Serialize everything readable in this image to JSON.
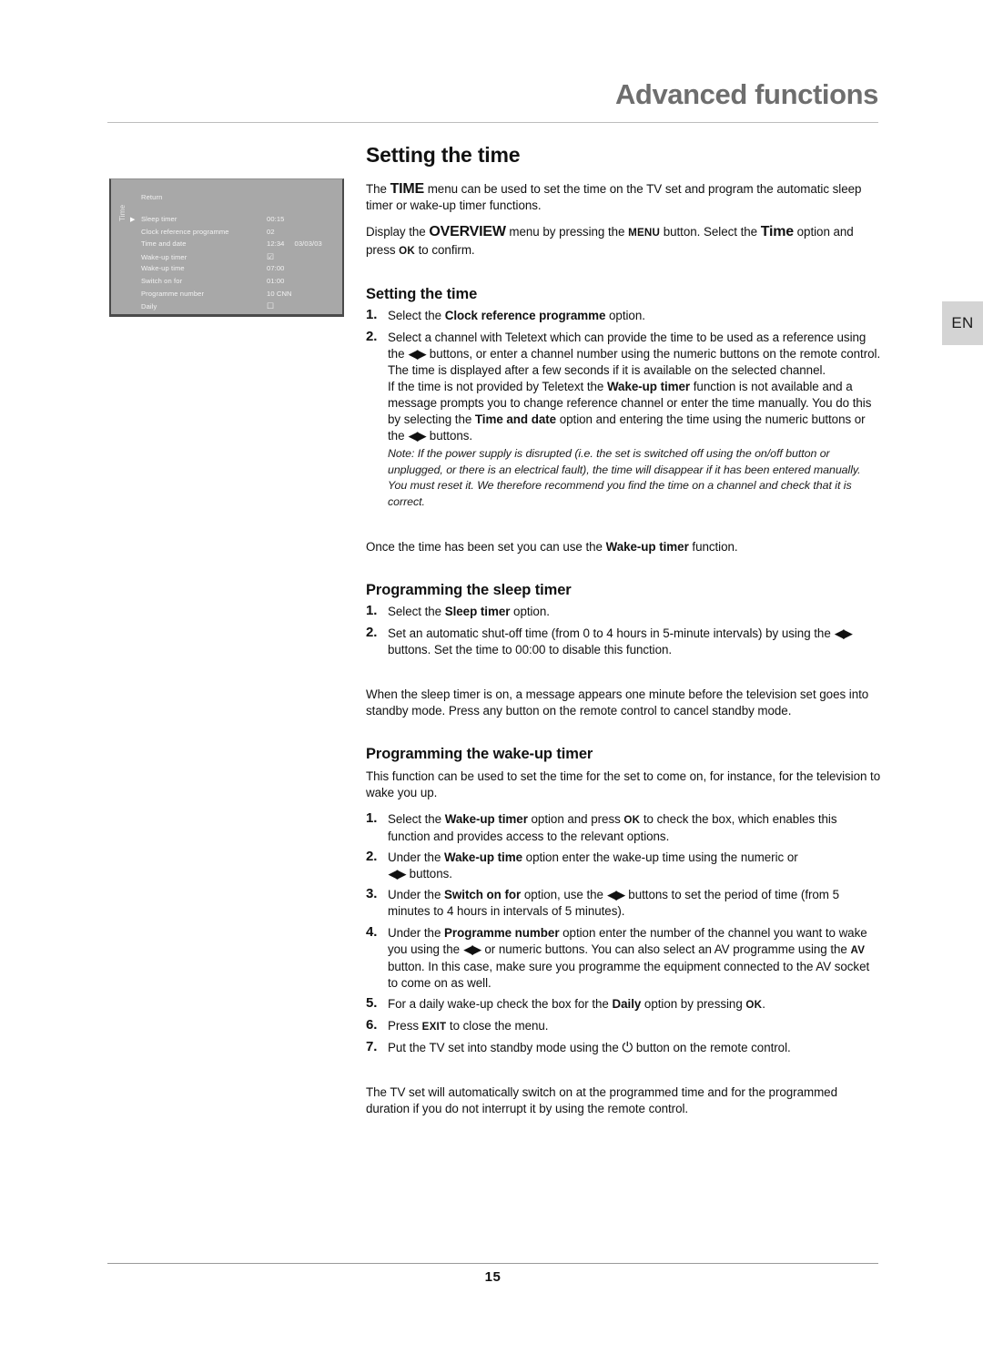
{
  "header": {
    "title": "Advanced functions",
    "language_tab": "EN"
  },
  "osd": {
    "vertical_label": "Time",
    "return_label": "Return",
    "cursor_glyph": "▶",
    "rows": [
      {
        "label": "Sleep timer",
        "value": "00:15",
        "date": "",
        "selected": true
      },
      {
        "label": "Clock reference programme",
        "value": "02",
        "date": "",
        "selected": false
      },
      {
        "label": "Time and date",
        "value": "12:34",
        "date": "03/03/03",
        "selected": false
      },
      {
        "label": "Wake-up timer",
        "value": "☑",
        "date": "",
        "selected": false
      },
      {
        "label": "Wake-up time",
        "value": "07:00",
        "date": "",
        "selected": false
      },
      {
        "label": "Switch on for",
        "value": "01:00",
        "date": "",
        "selected": false
      },
      {
        "label": "Programme number",
        "value": "10 CNN",
        "date": "",
        "selected": false
      },
      {
        "label": "Daily",
        "value": "☐",
        "date": "",
        "selected": false
      }
    ]
  },
  "main": {
    "section_title": "Setting the time",
    "intro_1_a": "The ",
    "intro_1_time": "TIME",
    "intro_1_b": " menu can be used to set the time on the TV set and program the automatic sleep timer or wake-up timer functions.",
    "intro_2_a": "Display the ",
    "intro_2_overview": "OVERVIEW",
    "intro_2_b": " menu by pressing the ",
    "intro_2_menu": "MENU",
    "intro_2_c": " button. Select the ",
    "intro_2_time": "Time",
    "intro_2_d": " option and press ",
    "intro_2_ok": "OK",
    "intro_2_e": " to confirm.",
    "setting_heading": "Setting the time",
    "setting_step1_num": "1.",
    "setting_step1_a": "Select the ",
    "setting_step1_bold": "Clock reference programme",
    "setting_step1_b": " option.",
    "setting_step2_num": "2.",
    "setting_step2_a": "Select a channel with Teletext which can provide the time to be used as a reference using the ",
    "setting_step2_arrows": "◀▶",
    "setting_step2_b": " buttons, or enter a channel number using the numeric buttons on the remote control. The time is displayed after a few seconds if it is available on the selected channel.",
    "setting_step2_c": "If the time is not provided by Teletext the ",
    "setting_step2_bold1": "Wake-up timer",
    "setting_step2_d": " function is not available and a message prompts you to change reference channel or enter the time manually. You do this by selecting the ",
    "setting_step2_bold2": "Time and date",
    "setting_step2_e": " option and entering the time using the numeric buttons or the ",
    "setting_step2_f": " buttons.",
    "setting_note": "Note: If the power supply is disrupted (i.e. the set is switched off using the on/off button or unplugged, or there is an electrical fault), the time will disappear if it has been entered manually. You must reset it. We therefore recommend you find the time on a channel and check that it is correct.",
    "once_a": "Once the time has been set you can use the ",
    "once_bold": "Wake-up timer",
    "once_b": " function.",
    "sleep_heading": "Programming the sleep timer",
    "sleep_step1_num": "1.",
    "sleep_step1_a": "Select the ",
    "sleep_step1_bold": "Sleep timer",
    "sleep_step1_b": " option.",
    "sleep_step2_num": "2.",
    "sleep_step2_a": "Set an automatic shut-off time (from 0 to 4 hours in 5-minute intervals) by using the ",
    "sleep_step2_arrows": "◀▶",
    "sleep_step2_b": " buttons. Set the time to 00:00 to disable this function.",
    "sleep_para": "When the sleep timer is on, a message appears one minute before the television set goes into standby mode. Press any button on the remote control to cancel standby mode.",
    "wake_heading": "Programming the wake-up timer",
    "wake_intro": "This function can be used to set the time for the set to come on, for instance, for the television to wake you up.",
    "wake_step1_num": "1.",
    "wake_step1_a": "Select the ",
    "wake_step1_bold": "Wake-up timer",
    "wake_step1_b": " option and press ",
    "wake_step1_ok": "OK",
    "wake_step1_c": " to check the box, which enables this function and provides access to the relevant options.",
    "wake_step2_num": "2.",
    "wake_step2_a": "Under the ",
    "wake_step2_bold": "Wake-up time",
    "wake_step2_b": " option enter the wake-up time using the numeric or ",
    "wake_step2_arrows": "◀▶",
    "wake_step2_c": " buttons.",
    "wake_step3_num": "3.",
    "wake_step3_a": "Under the ",
    "wake_step3_bold": "Switch on for",
    "wake_step3_b": " option, use the ",
    "wake_step3_arrows": "◀▶",
    "wake_step3_c": " buttons to set the period of time (from 5 minutes to 4 hours in intervals of 5 minutes).",
    "wake_step4_num": "4.",
    "wake_step4_a": "Under the ",
    "wake_step4_bold": "Programme number",
    "wake_step4_b": " option enter the number of the channel you want to wake you using the ",
    "wake_step4_arrows": "◀▶",
    "wake_step4_c": " or numeric buttons. You can also select an AV programme using the ",
    "wake_step4_av": "AV",
    "wake_step4_d": " button. In this case, make sure you programme the equipment connected to the AV socket to come on as well.",
    "wake_step5_num": "5.",
    "wake_step5_a": "For a daily wake-up check the box for the ",
    "wake_step5_bold": "Daily",
    "wake_step5_b": " option by pressing ",
    "wake_step5_ok": "OK",
    "wake_step5_c": ".",
    "wake_step6_num": "6.",
    "wake_step6_a": "Press ",
    "wake_step6_exit": "EXIT",
    "wake_step6_b": " to close the menu.",
    "wake_step7_num": "7.",
    "wake_step7_a": "Put the TV set into standby mode using the ",
    "wake_step7_power": "⏻",
    "wake_step7_b": " button on the remote control.",
    "closing": "The TV set will automatically switch on at the programmed time and for the programmed duration if you do not interrupt it by using the remote control."
  },
  "footer": {
    "page_number": "15"
  }
}
